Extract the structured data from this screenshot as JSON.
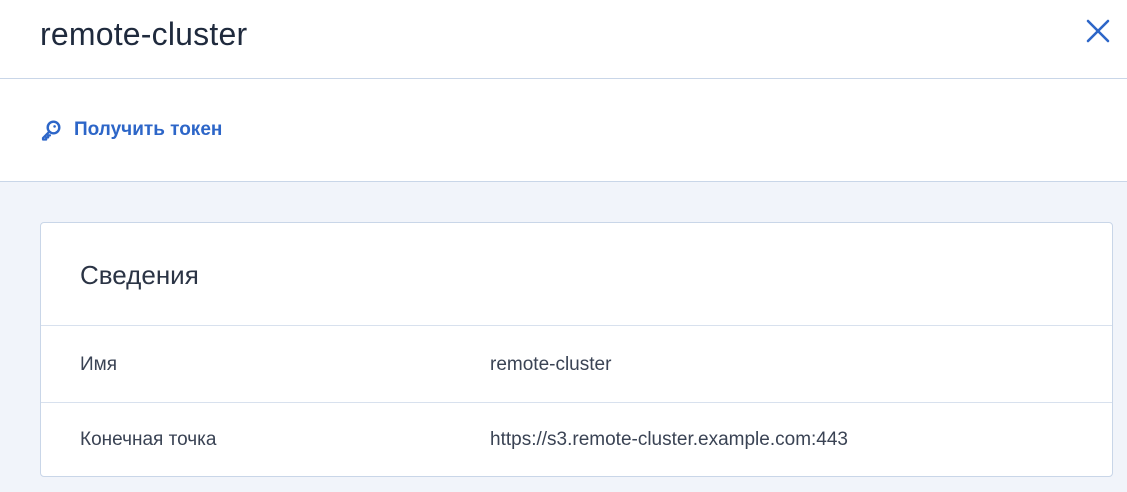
{
  "header": {
    "title": "remote-cluster",
    "close_icon": "close-icon"
  },
  "toolbar": {
    "token_icon": "key-icon",
    "token_label": "Получить токен"
  },
  "details": {
    "title": "Сведения",
    "rows": [
      {
        "label": "Имя",
        "value": "remote-cluster"
      },
      {
        "label": "Конечная точка",
        "value": "https://s3.remote-cluster.example.com:443"
      }
    ]
  },
  "colors": {
    "accent": "#2d66c8",
    "border": "#c9d6e8",
    "content_bg": "#f1f4fa"
  }
}
